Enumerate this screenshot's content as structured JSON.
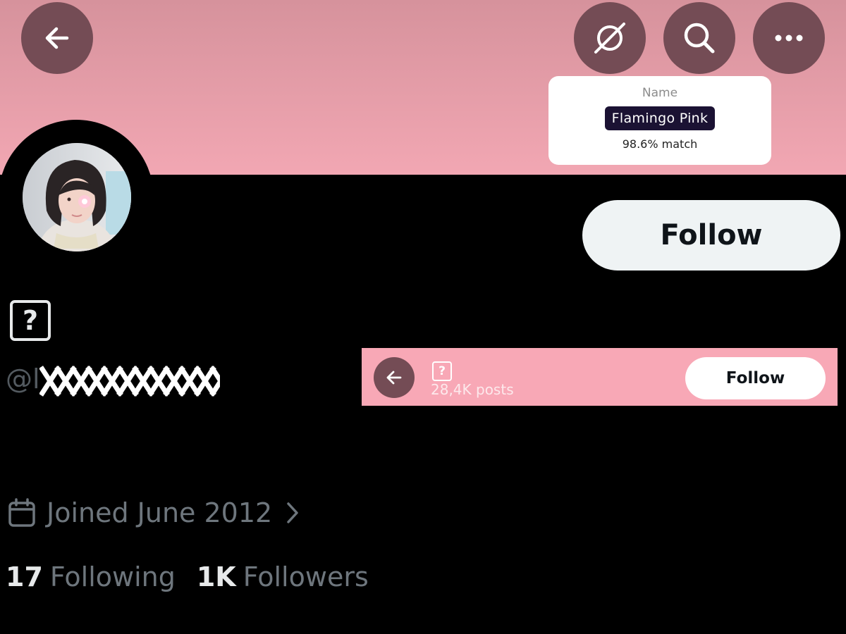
{
  "header": {
    "back_icon": "arrow-left-icon",
    "grok_icon": "slashed-circle-icon",
    "search_icon": "search-icon",
    "more_icon": "more-horizontal-icon",
    "banner_color_top": "#d6929c",
    "banner_color_bottom": "#f2a7b3",
    "button_color": "#744c55"
  },
  "color_popup": {
    "label": "Name",
    "color_name": "Flamingo Pink",
    "match": "98.6% match"
  },
  "profile": {
    "avatar_icon": "avatar-photo",
    "display_name_glyph": "?",
    "handle_prefix": "@l",
    "follow_label": "Follow",
    "joined": "Joined June 2012",
    "calendar_icon": "calendar-icon",
    "chevron_icon": "chevron-right-icon",
    "following_count": "17",
    "following_label": "Following",
    "followers_count": "1K",
    "followers_label": "Followers"
  },
  "sticky_header": {
    "back_icon": "arrow-left-icon",
    "name_glyph": "?",
    "posts": "28,4K posts",
    "follow_label": "Follow",
    "background": "#f8a8b6"
  }
}
